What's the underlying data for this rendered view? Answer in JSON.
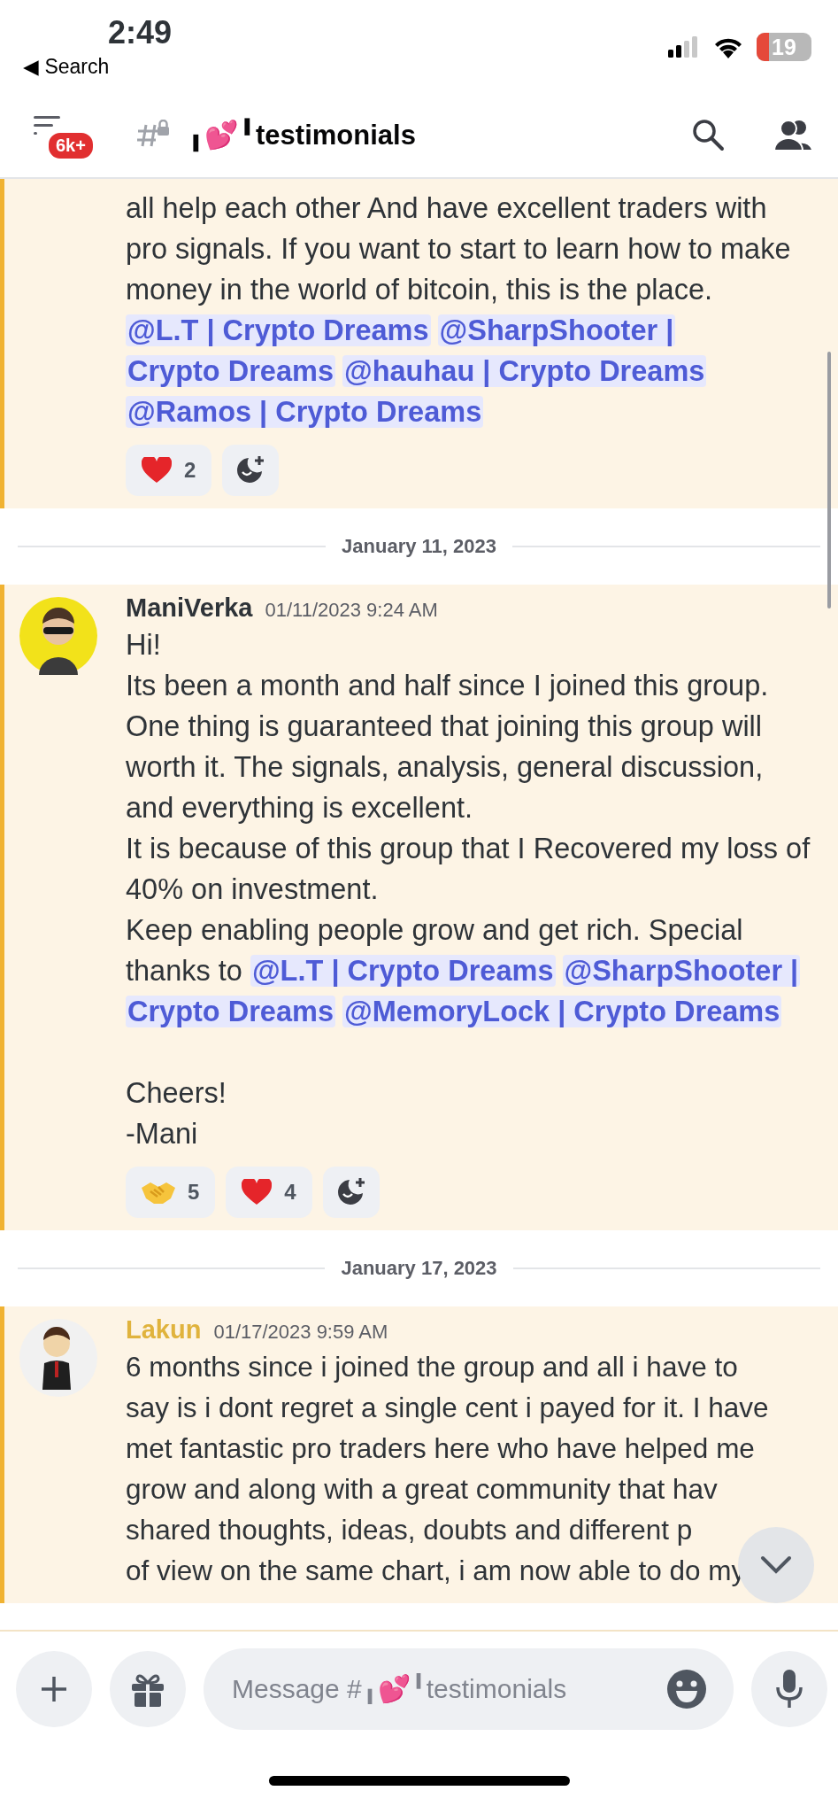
{
  "status_bar": {
    "time": "2:49",
    "back_arrow": "◀",
    "back_label": "Search",
    "battery": "19"
  },
  "header": {
    "badge": "6k+",
    "channel": "╻💕╹testimonials"
  },
  "feed": [
    {
      "kind": "message",
      "highlighted": true,
      "blocks": [
        [
          {
            "segments": [
              {
                "kind": "text",
                "text": "all help each other And have excellent traders with pro signals. If you want to start to learn how to make money in the world of bitcoin, this is the place. "
              },
              {
                "kind": "mention",
                "text": "@L.T | Crypto Dreams"
              },
              {
                "kind": "mention",
                "text": "@SharpShooter |"
              },
              {
                "kind": "mention",
                "text": "Crypto Dreams"
              },
              {
                "kind": "mention",
                "text": "@hauhau | Crypto Dreams"
              },
              {
                "kind": "mention",
                "text": "@Ramos | Crypto Dreams"
              }
            ]
          }
        ]
      ],
      "reactions": [
        {
          "kind": "heart",
          "count": "2"
        }
      ]
    },
    {
      "kind": "divider",
      "text": "January 11, 2023"
    },
    {
      "kind": "message",
      "highlighted": true,
      "author": {
        "name": "ManiVerka",
        "color": "#2e3338",
        "kind": "sunglasses"
      },
      "timestamp": "01/11/2023 9:24 AM",
      "blocks": [
        [
          {
            "segments": [
              {
                "kind": "text",
                "text": "Hi!"
              }
            ]
          },
          {
            "segments": [
              {
                "kind": "text",
                "text": "Its been a month and half since I joined this group. One thing is guaranteed that joining this group will worth it. The signals, analysis, general discussion, and everything is excellent."
              }
            ]
          },
          {
            "segments": [
              {
                "kind": "text",
                "text": "It is because of this group that I Recovered my loss of 40% on investment."
              }
            ]
          },
          {
            "segments": [
              {
                "kind": "text",
                "text": "Keep enabling people grow and get rich. Special thanks to "
              },
              {
                "kind": "mention",
                "text": "@L.T | Crypto Dreams"
              },
              {
                "kind": "mention",
                "text": "@SharpShooter |"
              },
              {
                "kind": "mention",
                "text": "Crypto Dreams"
              },
              {
                "kind": "mention",
                "text": "@MemoryLock | Crypto Dreams"
              }
            ]
          }
        ],
        [
          {
            "segments": [
              {
                "kind": "text",
                "text": "Cheers!"
              }
            ]
          },
          {
            "segments": [
              {
                "kind": "text",
                "text": "-Mani"
              }
            ]
          }
        ]
      ],
      "reactions": [
        {
          "kind": "handshake",
          "count": "5"
        },
        {
          "kind": "heart",
          "count": "4"
        }
      ]
    },
    {
      "kind": "divider",
      "text": "January 17, 2023"
    },
    {
      "kind": "message",
      "highlighted": true,
      "author": {
        "name": "Lakun",
        "color": "#e0b33d",
        "kind": "suit"
      },
      "timestamp": "01/17/2023 9:59 AM",
      "blocks": [
        [
          {
            "segments": [
              {
                "kind": "text",
                "text": "6 months since i joined the group and all i have to"
              }
            ]
          },
          {
            "segments": [
              {
                "kind": "text",
                "text": "say is i dont regret a single cent i payed for it. I have"
              }
            ]
          },
          {
            "segments": [
              {
                "kind": "text",
                "text": "met fantastic pro traders here who have helped me"
              }
            ]
          },
          {
            "segments": [
              {
                "kind": "text",
                "text": "grow and along with a great community that hav"
              }
            ]
          },
          {
            "segments": [
              {
                "kind": "text",
                "text": "shared thoughts, ideas, doubts and different p"
              }
            ]
          },
          {
            "segments": [
              {
                "kind": "text",
                "text": "of view on the same chart, i am now able to do my"
              }
            ]
          }
        ]
      ]
    }
  ],
  "composer": {
    "placeholder": "Message #╻💕╹testimonials"
  }
}
